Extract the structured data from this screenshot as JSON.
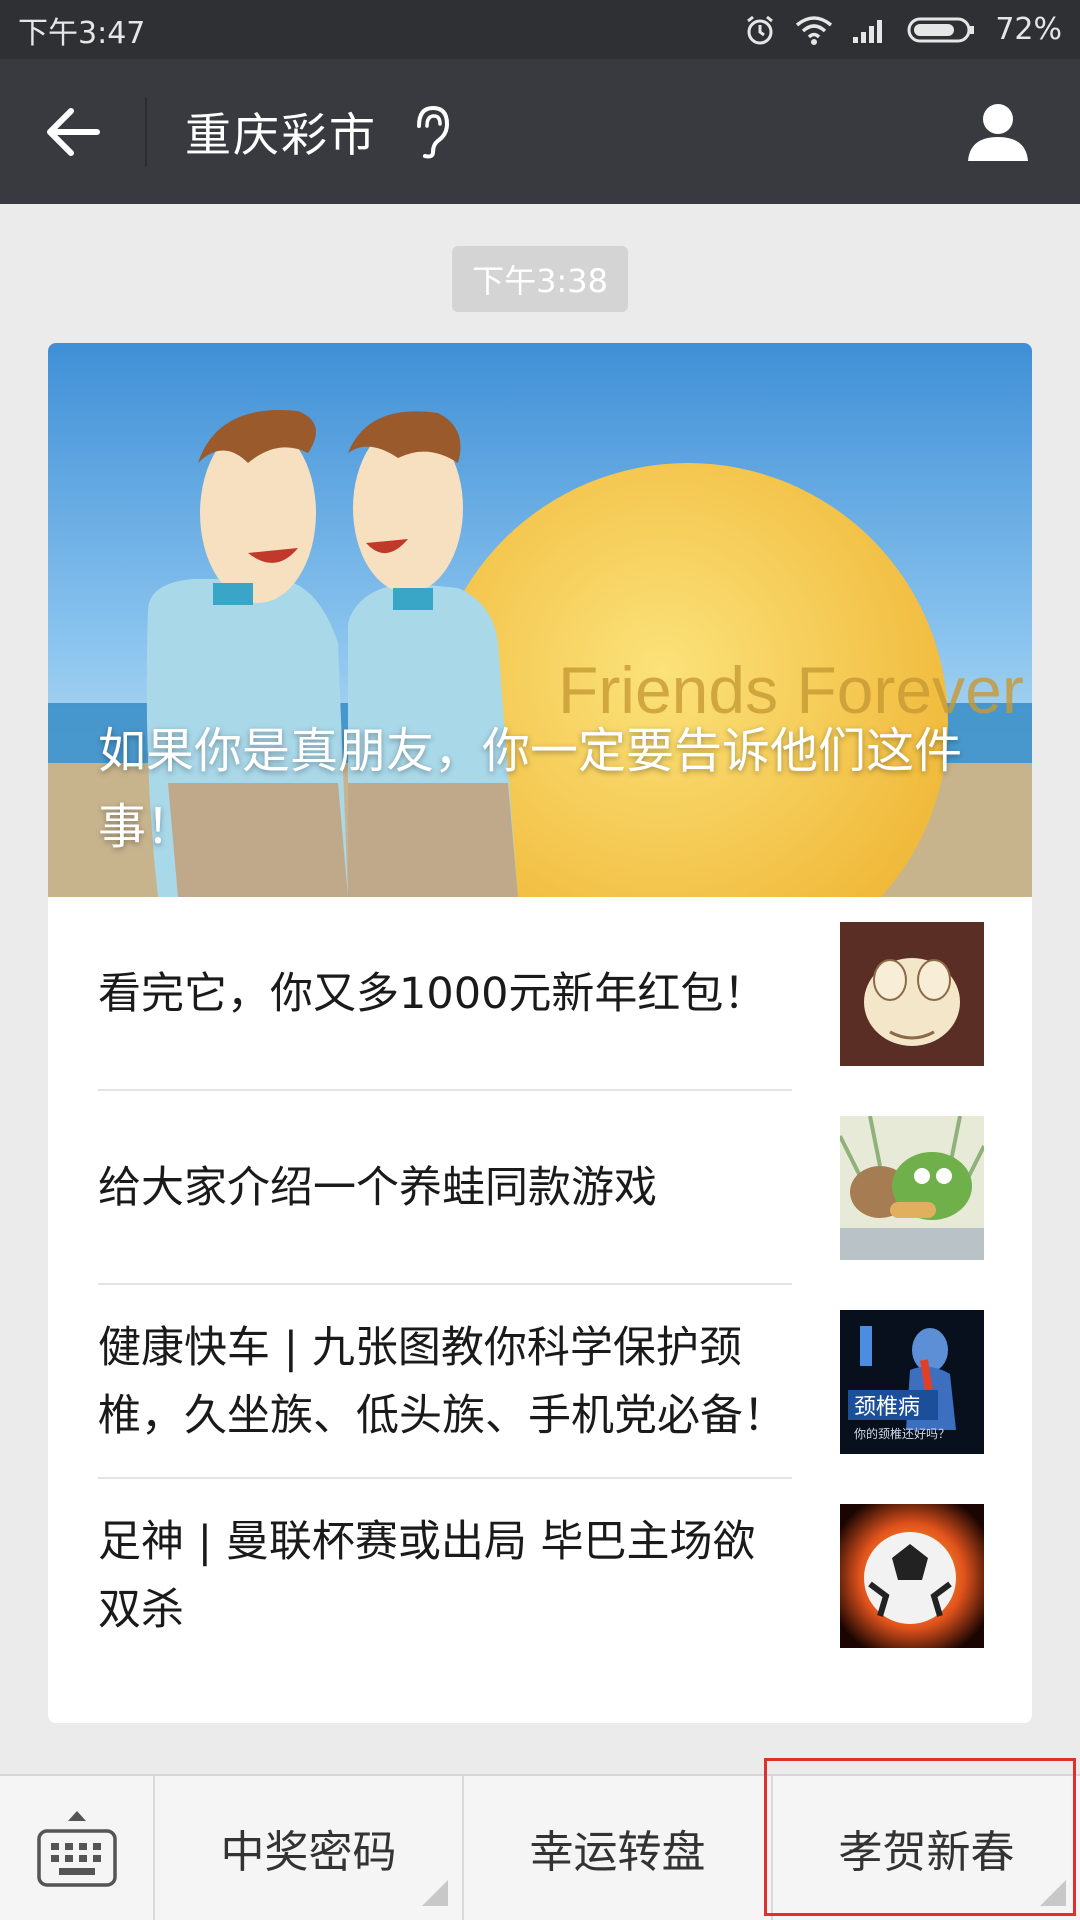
{
  "status_bar": {
    "time": "下午3:47",
    "battery": "72%"
  },
  "header": {
    "title": "重庆彩市"
  },
  "chat": {
    "timestamp": "下午3:38",
    "cover": {
      "title": "如果你是真朋友，你一定要告诉他们这件事！",
      "image_text": "Friends Forever"
    },
    "articles": [
      {
        "title": "看完它，你又多1000元新年红包！"
      },
      {
        "title": "给大家介绍一个养蛙同款游戏"
      },
      {
        "title": "健康快车 | 九张图教你科学保护颈椎，久坐族、低头族、手机党必备！",
        "thumb_text": "颈椎病",
        "thumb_subtext": "你的颈椎还好吗？"
      },
      {
        "title": "足神 | 曼联杯赛或出局 毕巴主场欲双杀"
      }
    ]
  },
  "menu": {
    "items": [
      {
        "label": "中奖密码"
      },
      {
        "label": "幸运转盘"
      },
      {
        "label": "孝贺新春"
      }
    ]
  },
  "colors": {
    "titlebar": "#393a3f",
    "statusbar": "#2f3033",
    "highlight": "#e0302a"
  }
}
